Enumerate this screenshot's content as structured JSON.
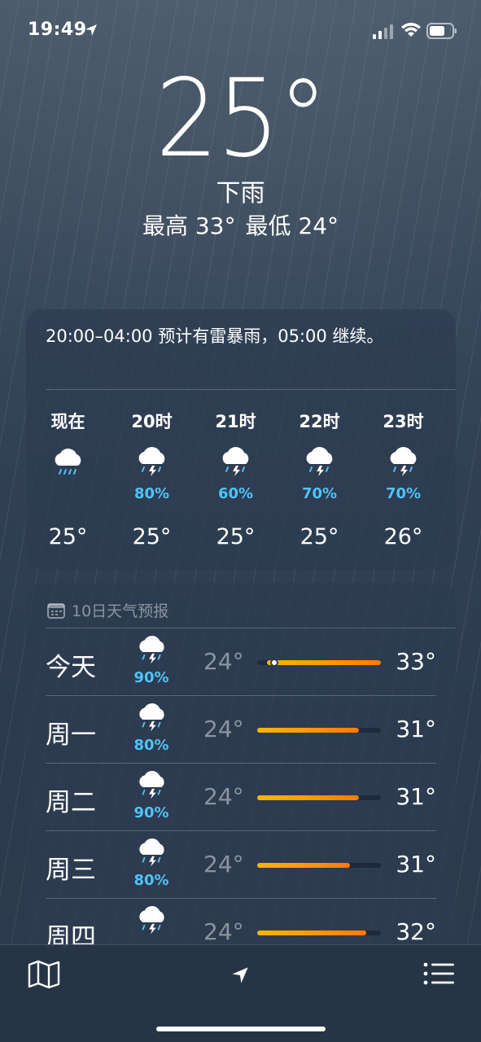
{
  "status_bar": {
    "time": "19:49"
  },
  "current": {
    "temperature": "25°",
    "condition": "下雨",
    "high": "最高 33°",
    "low": "最低 24°"
  },
  "hourly": {
    "summary": "20:00–04:00 预计有雷暴雨，05:00 继续。",
    "hours": [
      {
        "label": "现在",
        "icon": "rain-cloud-icon",
        "precip": "",
        "temp": "25°"
      },
      {
        "label": "20时",
        "icon": "thunderstorm-icon",
        "precip": "80%",
        "temp": "25°"
      },
      {
        "label": "21时",
        "icon": "thunderstorm-icon",
        "precip": "60%",
        "temp": "25°"
      },
      {
        "label": "22时",
        "icon": "thunderstorm-icon",
        "precip": "70%",
        "temp": "25°"
      },
      {
        "label": "23时",
        "icon": "thunderstorm-icon",
        "precip": "70%",
        "temp": "26°"
      }
    ]
  },
  "daily": {
    "header": "10日天气预报",
    "days": [
      {
        "name": "今天",
        "icon": "thunderstorm-icon",
        "precip": "90%",
        "low": "24°",
        "high": "33°",
        "range_start": 0.08,
        "range_end": 1.0,
        "current_marker": 0.14
      },
      {
        "name": "周一",
        "icon": "thunderstorm-icon",
        "precip": "80%",
        "low": "24°",
        "high": "31°",
        "range_start": 0.0,
        "range_end": 0.82
      },
      {
        "name": "周二",
        "icon": "thunderstorm-icon",
        "precip": "90%",
        "low": "24°",
        "high": "31°",
        "range_start": 0.0,
        "range_end": 0.82
      },
      {
        "name": "周三",
        "icon": "thunderstorm-icon",
        "precip": "80%",
        "low": "24°",
        "high": "31°",
        "range_start": 0.0,
        "range_end": 0.75
      },
      {
        "name": "周四",
        "icon": "thunderstorm-icon",
        "precip": "",
        "low": "24°",
        "high": "32°",
        "range_start": 0.0,
        "range_end": 0.88
      }
    ]
  },
  "toolbar": {
    "map": "map-icon",
    "location": "location-arrow-icon",
    "list": "list-icon"
  },
  "colors": {
    "precip": "#4fc3f7",
    "bar_start": "#f5b700",
    "bar_end": "#ff7a00"
  }
}
